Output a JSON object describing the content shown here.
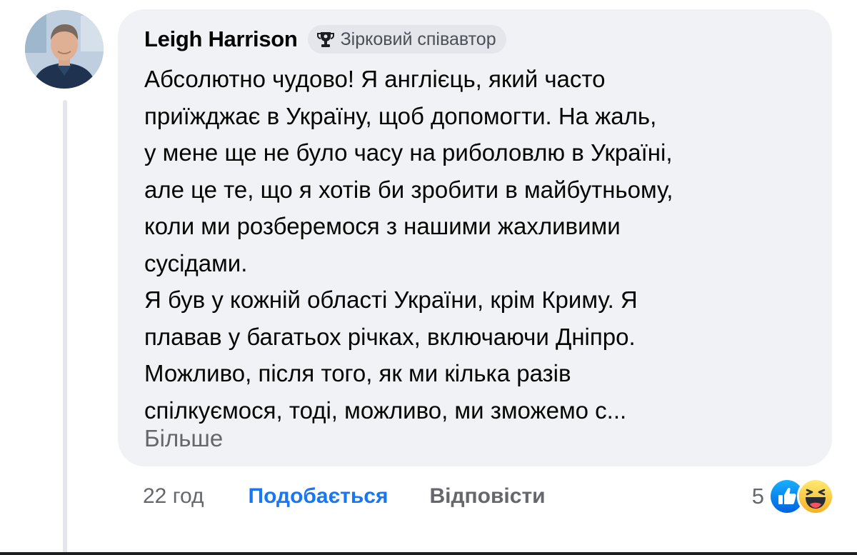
{
  "comment": {
    "author": "Leigh Harrison",
    "badge": {
      "icon": "trophy-icon",
      "label": "Зірковий співавтор"
    },
    "text_lines": [
      "Абсолютно чудово! Я англієць, який часто",
      "приїжджає в Україну, щоб допомогти. На жаль,",
      "у мене ще не було часу на риболовлю в Україні,",
      "але це те, що я хотів би зробити в майбутньому,",
      "коли ми розберемося з нашими жахливими",
      "сусідами.",
      "Я був у кожній області України, крім Криму. Я",
      "плавав у багатьох річках, включаючи Дніпро.",
      "Можливо, після того, як ми кілька разів",
      "спілкуємося, тоді, можливо, ми зможемо с..."
    ],
    "more_label": "Більше"
  },
  "actions": {
    "time": "22 год",
    "like_label": "Подобається",
    "reply_label": "Відповісти"
  },
  "reactions": {
    "count": "5",
    "icons": [
      "like-reaction-icon",
      "haha-reaction-icon"
    ]
  },
  "colors": {
    "bubble_bg": "#f0f2f5",
    "text": "#050505",
    "secondary_text": "#65676b",
    "accent": "#1877f2",
    "badge_bg": "#e4e6eb"
  }
}
